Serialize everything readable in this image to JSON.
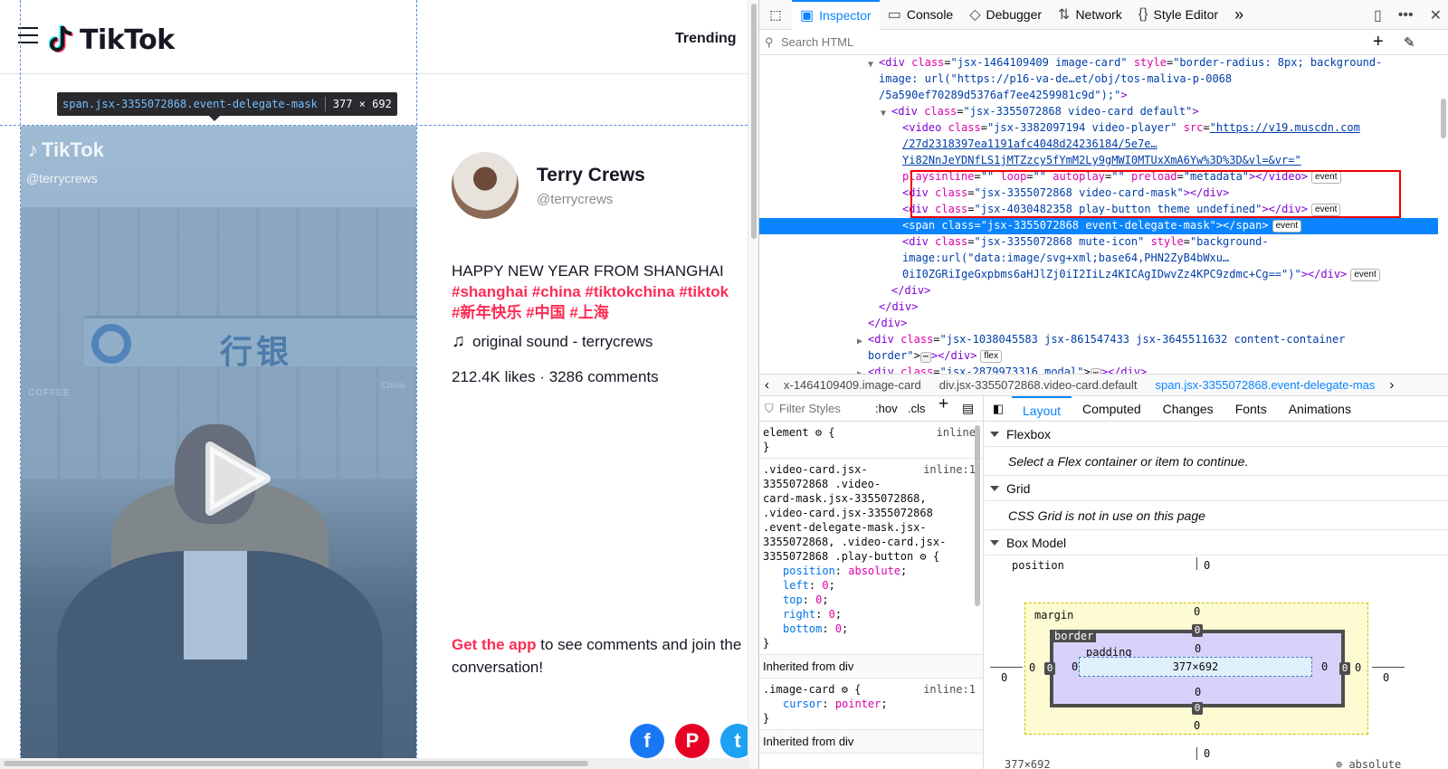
{
  "tiktok": {
    "logo_text": "TikTok",
    "nav_trending": "Trending",
    "tooltip": {
      "tag": "span",
      "cls": ".jsx-3355072868.event-delegate-mask",
      "size": "377 × 692"
    },
    "video": {
      "watermark": "TikTok",
      "handle": "@terrycrews",
      "sign_text": "行银",
      "coffee": "COFFEE",
      "china": "China"
    },
    "author": {
      "name": "Terry Crews",
      "handle": "@terrycrews"
    },
    "caption": "HAPPY NEW YEAR FROM SHANGHAI",
    "hashtags": "#shanghai #china #tiktokchina #tiktok",
    "hashtags_cn": "#新年快乐 #中国 #上海",
    "sound": "original sound - terrycrews",
    "stats": "212.4K likes · 3286 comments",
    "getapp_link": "Get the app",
    "getapp_text": " to see comments and join the",
    "getapp_text2": "conversation!",
    "social": [
      {
        "name": "facebook",
        "glyph": "f",
        "color": "#1877f2"
      },
      {
        "name": "pinterest",
        "glyph": "P",
        "color": "#e60023"
      },
      {
        "name": "twitter",
        "glyph": "t",
        "color": "#1da1f2"
      }
    ]
  },
  "devtools": {
    "tabs": [
      {
        "label": "Inspector",
        "icon": "▣",
        "active": true
      },
      {
        "label": "Console",
        "icon": "▭",
        "active": false
      },
      {
        "label": "Debugger",
        "icon": "◇",
        "active": false
      },
      {
        "label": "Network",
        "icon": "⇅",
        "active": false
      },
      {
        "label": "Style Editor",
        "icon": "{}",
        "active": false
      }
    ],
    "search_placeholder": "Search HTML",
    "markup": {
      "l1_tag": "<div",
      "l1_a1": "class",
      "l1_v1": "\"jsx-1464109409 image-card\"",
      "l1_a2": "style",
      "l1_v2a": "\"border-radius: 8px; background-",
      "l2_v": "image: url(\"https://p16-va-de…et/obj/tos-maliva-p-0068",
      "l3_v": "/5a590ef70289d5376af7ee4259981c9d\");\"",
      "l3_tag": ">",
      "l4_tag": "<div",
      "l4_a": "class",
      "l4_v": "\"jsx-3355072868 video-card default\"",
      "l4_end": ">",
      "l5_tag": "<video",
      "l5_a1": "class",
      "l5_v1": "\"jsx-3382097194 video-player\"",
      "l5_a2": "src",
      "l5_v2": "\"https://v19.muscdn.com",
      "l6_v": "/27d2318397ea1191afc4048d24236184/5e7e…",
      "l7_v": "Yi82NnJeYDNfLS1jMTZzcy5fYmM2Ly9gMWI0MTUxXmA6Yw%3D%3D&vl=&vr=\"",
      "l8_a1": "playsinline",
      "l8_v1": "\"\"",
      "l8_a2": "loop",
      "l8_v2": "\"\"",
      "l8_a3": "autoplay",
      "l8_v3": "\"\"",
      "l8_a4": "preload",
      "l8_v4": "\"metadata\"",
      "l8_end": "></video>",
      "l9_tag": "<div",
      "l9_a": "class",
      "l9_v": "\"jsx-3355072868 video-card-mask\"",
      "l9_end": "></div>",
      "l10_tag": "<div",
      "l10_a": "class",
      "l10_v": "\"jsx-4030482358 play-button theme undefined\"",
      "l10_end": "></div>",
      "l11_tag": "<span",
      "l11_a": "class",
      "l11_v": "\"jsx-3355072868 event-delegate-mask\"",
      "l11_end": "></span>",
      "l12_tag": "<div",
      "l12_a1": "class",
      "l12_v1": "\"jsx-3355072868 mute-icon\"",
      "l12_a2": "style",
      "l12_v2": "\"background-",
      "l13_v": "image:url(\"data:image/svg+xml;base64,PHN2ZyB4bWxu…",
      "l14_v": "0iI0ZGRiIgeGxpbms6aHJlZj0iI2IiLz4KICAgIDwvZz4KPC9zdmc+Cg==\")\"",
      "l14_end": "></div>",
      "l15": "</div>",
      "l16": "</div>",
      "l17": "</div>",
      "l18_tag": "<div",
      "l18_a": "class",
      "l18_v": "\"jsx-1038045583 jsx-861547433 jsx-3645511632 content-container",
      "l19_v": "border\"",
      "l19_end": "></div>",
      "l19_badge": "flex",
      "l20_tag": "<div",
      "l20_a": "class",
      "l20_v": "\"jsx-2879973316 modal\"",
      "l20_end": "></div>",
      "event_badge": "event",
      "ellipsis": "⋯"
    },
    "breadcrumbs": [
      {
        "label": "x-1464109409.image-card",
        "current": false
      },
      {
        "label": "div.jsx-3355072868.video-card.default",
        "current": false
      },
      {
        "label": "span.jsx-3355072868.event-delegate-mas",
        "current": true
      }
    ],
    "rules": {
      "filter_placeholder": "Filter Styles",
      "hov": ":hov",
      "cls": ".cls",
      "element_sel": "element",
      "element_src": "inline",
      "r2_sel1": ".video-card.jsx-",
      "r2_sel2": "3355072868 .video-",
      "r2_sel3": "card-mask.jsx-3355072868,",
      "r2_sel4": ".video-card.jsx-3355072868",
      "r2_sel5": ".event-delegate-mask.jsx-",
      "r2_sel6": "3355072868, .video-card.jsx-",
      "r2_sel7": "3355072868 .play-button",
      "r2_src": "inline:1",
      "decls": [
        {
          "p": "position",
          "v": "absolute"
        },
        {
          "p": "left",
          "v": "0"
        },
        {
          "p": "top",
          "v": "0"
        },
        {
          "p": "right",
          "v": "0"
        },
        {
          "p": "bottom",
          "v": "0"
        }
      ],
      "inherited1": "Inherited from div",
      "r3_sel": ".image-card",
      "r3_src": "inline:1",
      "r3_p": "cursor",
      "r3_v": "pointer",
      "inherited2": "Inherited from div"
    },
    "layout": {
      "tabs": [
        {
          "label": "Layout",
          "active": true
        },
        {
          "label": "Computed",
          "active": false
        },
        {
          "label": "Changes",
          "active": false
        },
        {
          "label": "Fonts",
          "active": false
        },
        {
          "label": "Animations",
          "active": false
        }
      ],
      "flexbox_title": "Flexbox",
      "flexbox_msg": "Select a Flex container or item to continue.",
      "grid_title": "Grid",
      "grid_msg": "CSS Grid is not in use on this page",
      "boxmodel_title": "Box Model",
      "bm_position": "position",
      "bm_margin": "margin",
      "bm_border": "border",
      "bm_padding": "padding",
      "bm_content": "377×692",
      "zero": "0",
      "footer_left": "377×692",
      "footer_right": "absolute"
    }
  }
}
